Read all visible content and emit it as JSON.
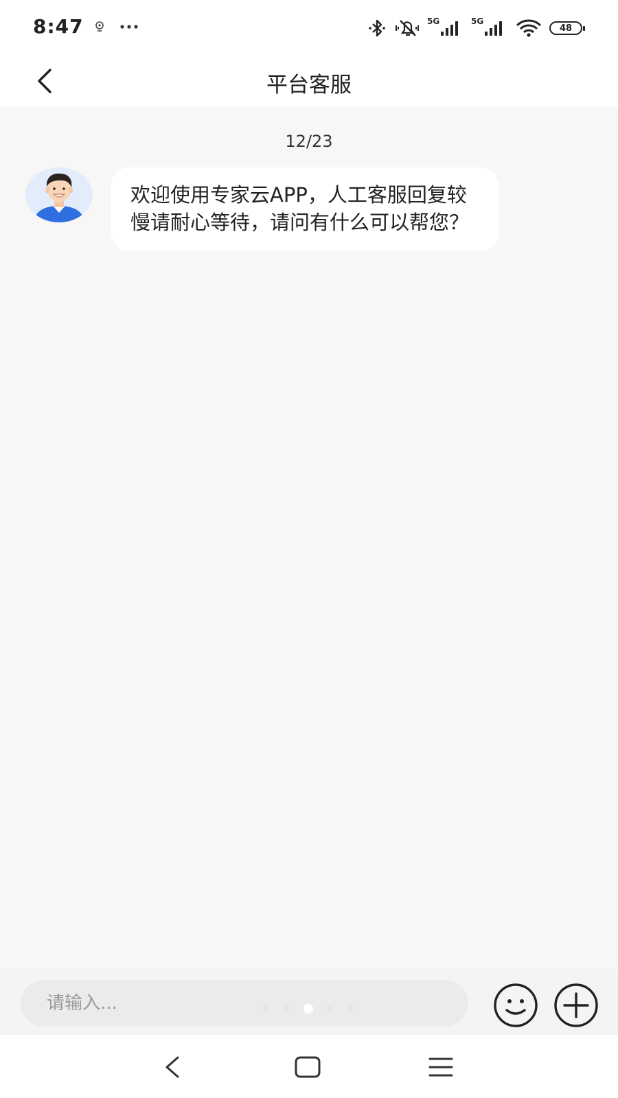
{
  "status_bar": {
    "time": "8:47",
    "signal_1_label": "5G",
    "signal_2_label": "5G",
    "battery": "48",
    "icons": [
      "location-icon",
      "more-dots-icon",
      "bluetooth-icon",
      "mute-icon",
      "signal-icon",
      "wifi-icon",
      "battery-icon"
    ]
  },
  "header": {
    "title": "平台客服"
  },
  "chat": {
    "date": "12/23",
    "messages": [
      {
        "sender": "agent",
        "text": "欢迎使用专家云APP，人工客服回复较慢请耐心等待，请问有什么可以帮您？"
      }
    ]
  },
  "input_bar": {
    "placeholder": "请输入..."
  },
  "colors": {
    "background": "#f7f7f7",
    "bubble": "#ffffff",
    "avatar_jacket": "#2f6fe0",
    "text": "#222222"
  }
}
